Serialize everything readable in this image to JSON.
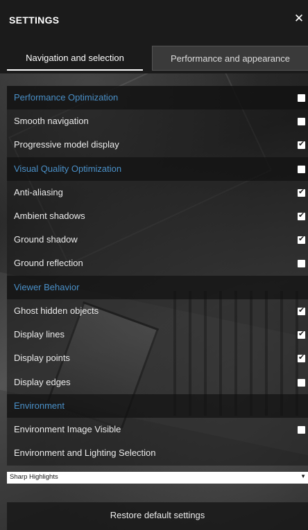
{
  "panel": {
    "title": "SETTINGS",
    "close_label": "✕"
  },
  "tabs": [
    {
      "label": "Navigation and selection",
      "active": true
    },
    {
      "label": "Performance and appearance",
      "active": false
    }
  ],
  "rows": [
    {
      "type": "section",
      "label": "Performance Optimization",
      "checkbox": true,
      "checked": false
    },
    {
      "type": "option",
      "label": "Smooth navigation",
      "checkbox": true,
      "checked": false
    },
    {
      "type": "option",
      "label": "Progressive model display",
      "checkbox": true,
      "checked": true
    },
    {
      "type": "section",
      "label": "Visual Quality Optimization",
      "checkbox": true,
      "checked": false
    },
    {
      "type": "option",
      "label": "Anti-aliasing",
      "checkbox": true,
      "checked": true
    },
    {
      "type": "option",
      "label": "Ambient shadows",
      "checkbox": true,
      "checked": true
    },
    {
      "type": "option",
      "label": "Ground shadow",
      "checkbox": true,
      "checked": true
    },
    {
      "type": "option",
      "label": "Ground reflection",
      "checkbox": true,
      "checked": false
    },
    {
      "type": "section",
      "label": "Viewer Behavior",
      "checkbox": false,
      "checked": false
    },
    {
      "type": "option",
      "label": "Ghost hidden objects",
      "checkbox": true,
      "checked": true
    },
    {
      "type": "option",
      "label": "Display lines",
      "checkbox": true,
      "checked": true
    },
    {
      "type": "option",
      "label": "Display points",
      "checkbox": true,
      "checked": true
    },
    {
      "type": "option",
      "label": "Display edges",
      "checkbox": true,
      "checked": false
    },
    {
      "type": "section",
      "label": "Environment",
      "checkbox": false,
      "checked": false
    },
    {
      "type": "option",
      "label": "Environment Image Visible",
      "checkbox": true,
      "checked": false
    },
    {
      "type": "option",
      "label": "Environment and Lighting Selection",
      "checkbox": false,
      "checked": false
    }
  ],
  "dropdown": {
    "selected": "Sharp Highlights",
    "arrow": "▼"
  },
  "restore_label": "Restore default settings",
  "colors": {
    "section_text": "#4a90c8",
    "header_bg": "#1b1b1b"
  },
  "checkmark": "✔"
}
